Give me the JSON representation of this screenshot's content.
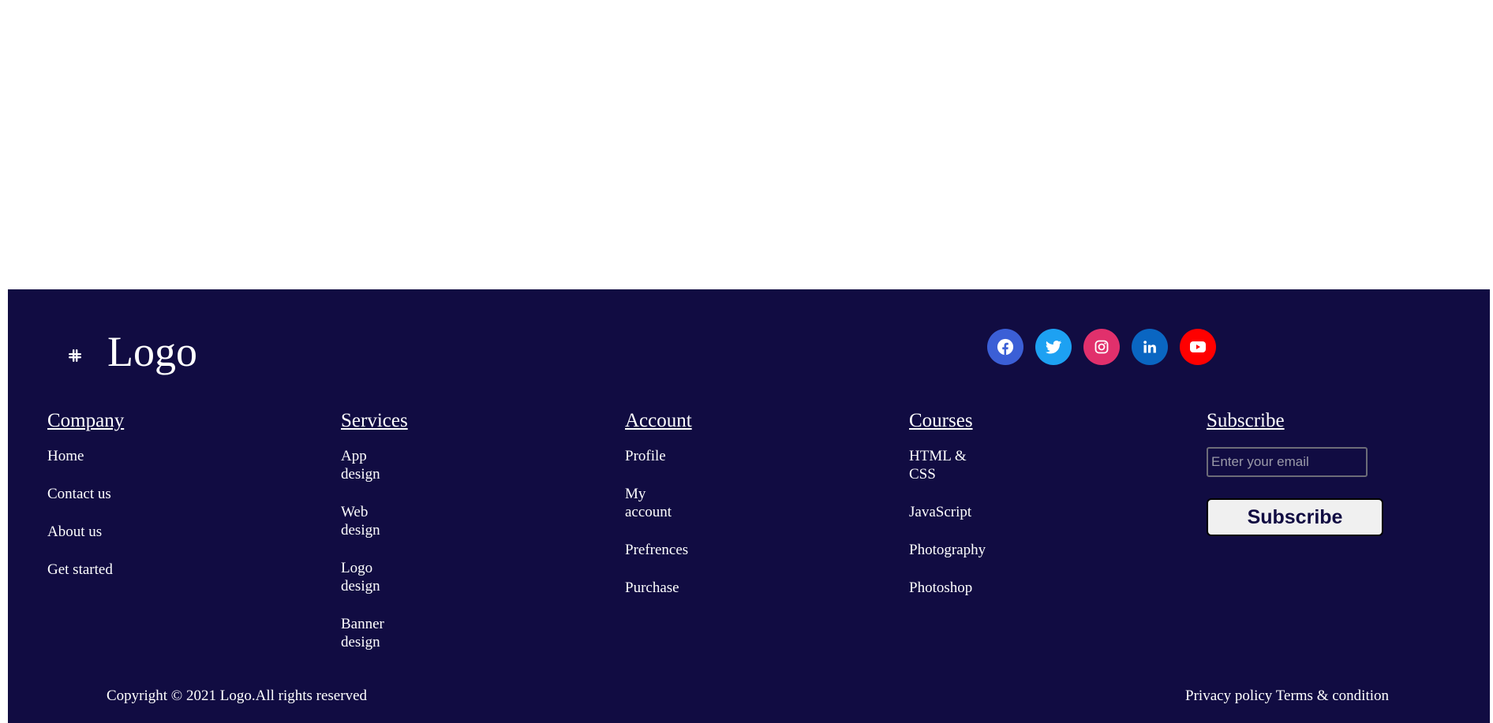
{
  "brand": {
    "logo_text": "Logo",
    "icon": "slack-like-logo-icon"
  },
  "colors": {
    "footer_bg": "#110c42",
    "facebook": "#3b5fd6",
    "twitter": "#1da1f2",
    "instagram": "#e1306c",
    "linkedin": "#0a66c2",
    "youtube": "#ff0000"
  },
  "social": [
    {
      "name": "facebook",
      "icon": "facebook-icon"
    },
    {
      "name": "twitter",
      "icon": "twitter-icon"
    },
    {
      "name": "instagram",
      "icon": "instagram-icon"
    },
    {
      "name": "linkedin",
      "icon": "linkedin-icon"
    },
    {
      "name": "youtube",
      "icon": "youtube-icon"
    }
  ],
  "columns": {
    "company": {
      "heading": "Company",
      "links": [
        "Home",
        "Contact us",
        "About us",
        "Get started"
      ]
    },
    "services": {
      "heading": "Services",
      "links": [
        "App design",
        "Web design",
        "Logo design",
        "Banner design"
      ]
    },
    "account": {
      "heading": "Account",
      "links": [
        "Profile",
        "My account",
        "Prefrences",
        "Purchase"
      ]
    },
    "courses": {
      "heading": "Courses",
      "links": [
        "HTML & CSS",
        "JavaScript",
        "Photography",
        "Photoshop"
      ]
    }
  },
  "subscribe": {
    "heading": "Subscribe",
    "email_placeholder": "Enter your email",
    "email_value": "",
    "button_label": "Subscribe"
  },
  "bottom": {
    "copyright": "Copyright © 2021 Logo.All rights reserved",
    "privacy": "Privacy policy",
    "terms": "Terms & condition"
  }
}
